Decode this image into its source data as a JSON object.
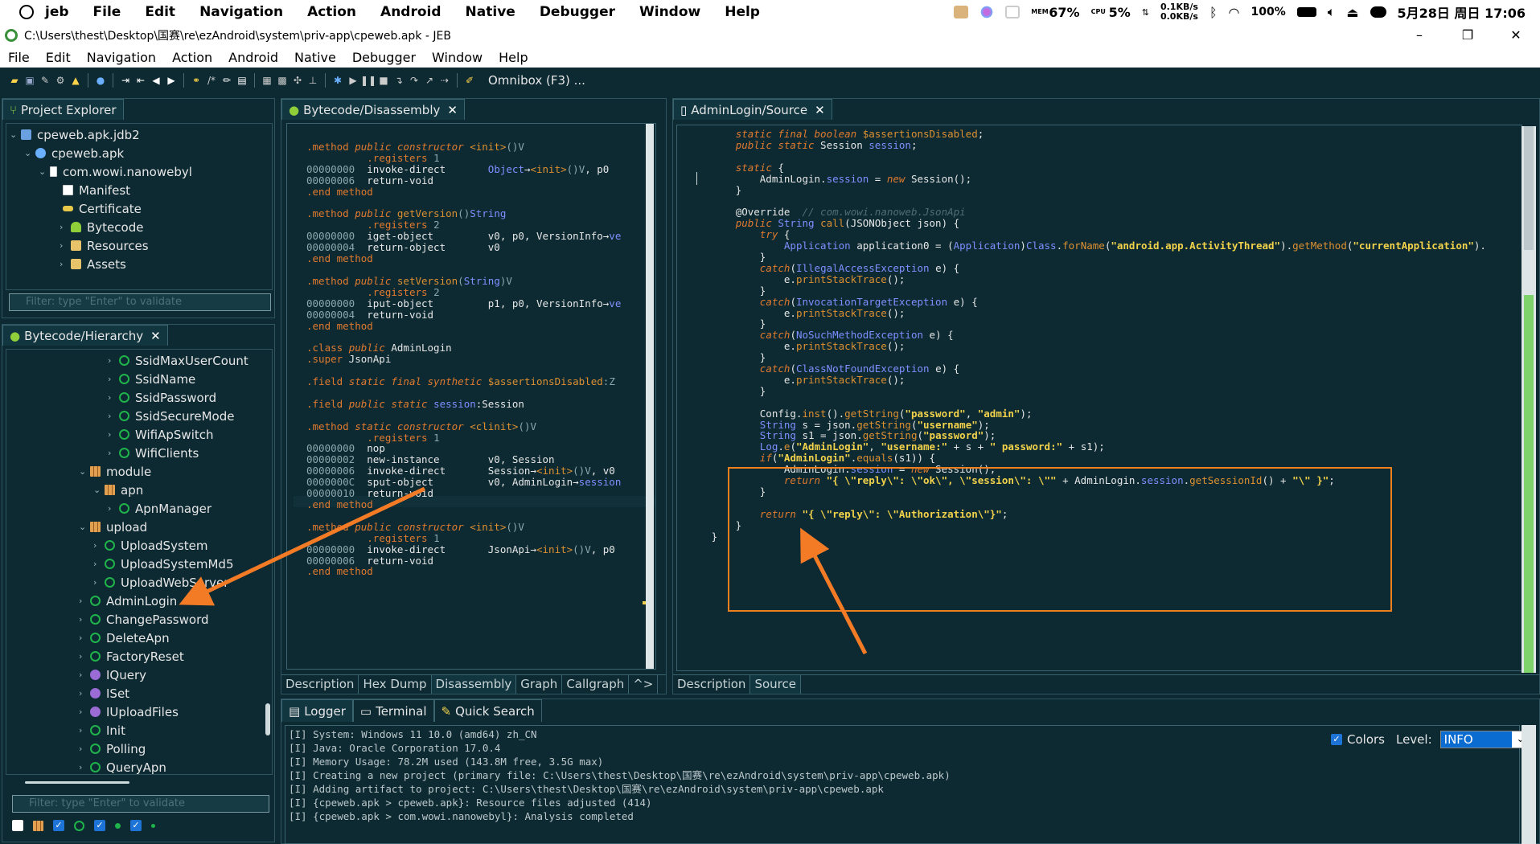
{
  "system_menubar": {
    "app_name": "jeb",
    "items": [
      "File",
      "Edit",
      "Navigation",
      "Action",
      "Android",
      "Native",
      "Debugger",
      "Window",
      "Help"
    ],
    "mem_label": "MEM",
    "mem_value": "67%",
    "cpu_label": "CPU",
    "cpu_value": "5%",
    "net_up": "0.1KB/s",
    "net_down": "0.0KB/s",
    "battery": "100%",
    "datetime": "5月28日 周日 17:06"
  },
  "window": {
    "title": "C:\\Users\\thest\\Desktop\\国赛\\re\\ezAndroid\\system\\priv-app\\cpeweb.apk - JEB",
    "minimize": "–",
    "maximize": "❐",
    "close": "✕"
  },
  "menubar": {
    "items": [
      "File",
      "Edit",
      "Navigation",
      "Action",
      "Android",
      "Native",
      "Debugger",
      "Window",
      "Help"
    ]
  },
  "toolbar": {
    "omnibox": "Omnibox (F3) ..."
  },
  "project_explorer": {
    "tab": "Project Explorer",
    "items": [
      {
        "label": "cpeweb.apk.jdb2",
        "icon": "project-icon"
      },
      {
        "label": "cpeweb.apk",
        "icon": "apk-icon"
      },
      {
        "label": "com.wowi.nanowebyl",
        "icon": "artifact-icon"
      },
      {
        "label": "Manifest",
        "icon": "manifest-icon"
      },
      {
        "label": "Certificate",
        "icon": "key-icon"
      },
      {
        "label": "Bytecode",
        "icon": "android-icon"
      },
      {
        "label": "Resources",
        "icon": "folder-icon"
      },
      {
        "label": "Assets",
        "icon": "folder-icon"
      }
    ],
    "filter_placeholder": "Filter: type \"Enter\" to validate"
  },
  "hierarchy": {
    "tab": "Bytecode/Hierarchy",
    "items": [
      {
        "label": "SsidMaxUserCount",
        "icon": "class-icon"
      },
      {
        "label": "SsidName",
        "icon": "class-icon"
      },
      {
        "label": "SsidPassword",
        "icon": "class-icon"
      },
      {
        "label": "SsidSecureMode",
        "icon": "class-icon"
      },
      {
        "label": "WifiApSwitch",
        "icon": "class-icon"
      },
      {
        "label": "WifiClients",
        "icon": "class-icon"
      },
      {
        "label": "module",
        "icon": "package-icon"
      },
      {
        "label": "apn",
        "icon": "package-icon"
      },
      {
        "label": "ApnManager",
        "icon": "class-icon"
      },
      {
        "label": "upload",
        "icon": "package-icon"
      },
      {
        "label": "UploadSystem",
        "icon": "class-icon"
      },
      {
        "label": "UploadSystemMd5",
        "icon": "class-icon"
      },
      {
        "label": "UploadWebServer",
        "icon": "class-icon"
      },
      {
        "label": "AdminLogin",
        "icon": "class-icon"
      },
      {
        "label": "ChangePassword",
        "icon": "class-icon"
      },
      {
        "label": "DeleteApn",
        "icon": "class-icon"
      },
      {
        "label": "FactoryReset",
        "icon": "class-icon"
      },
      {
        "label": "IQuery",
        "icon": "interface-icon"
      },
      {
        "label": "ISet",
        "icon": "interface-icon"
      },
      {
        "label": "IUploadFiles",
        "icon": "interface-icon"
      },
      {
        "label": "Init",
        "icon": "class-icon"
      },
      {
        "label": "Polling",
        "icon": "class-icon"
      },
      {
        "label": "QueryApn",
        "icon": "class-icon"
      }
    ],
    "filter_placeholder": "Filter: type \"Enter\" to validate"
  },
  "disassembly": {
    "tab": "Bytecode/Disassembly",
    "bottom_tabs": [
      "Description",
      "Hex Dump",
      "Disassembly",
      "Graph",
      "Callgraph",
      "^>"
    ]
  },
  "source": {
    "tab": "AdminLogin/Source",
    "bottom_tabs": [
      "Description",
      "Source"
    ]
  },
  "logger": {
    "tabs": [
      "Logger",
      "Terminal",
      "Quick Search"
    ],
    "colors_label": "Colors",
    "level_label": "Level:",
    "level_value": "INFO",
    "lines": [
      "[I] System: Windows 11 10.0 (amd64) zh_CN",
      "[I] Java: Oracle Corporation 17.0.4",
      "[I] Memory Usage: 78.2M used (143.8M free, 3.5G max)",
      "[I] Creating a new project (primary file: C:\\Users\\thest\\Desktop\\国赛\\re\\ezAndroid\\system\\priv-app\\cpeweb.apk)",
      "[I] Adding artifact to project: C:\\Users\\thest\\Desktop\\国赛\\re\\ezAndroid\\system\\priv-app\\cpeweb.apk",
      "[I] {cpeweb.apk > cpeweb.apk}: Resource files adjusted (414)",
      "[I] {cpeweb.apk > com.wowi.nanowebyl}: Analysis completed"
    ]
  },
  "colors": {
    "background": "#0d2a33",
    "annotation": "#f07f1e",
    "keyword": "#e07a2e",
    "string": "#f2d24a",
    "type": "#7f8fff"
  }
}
